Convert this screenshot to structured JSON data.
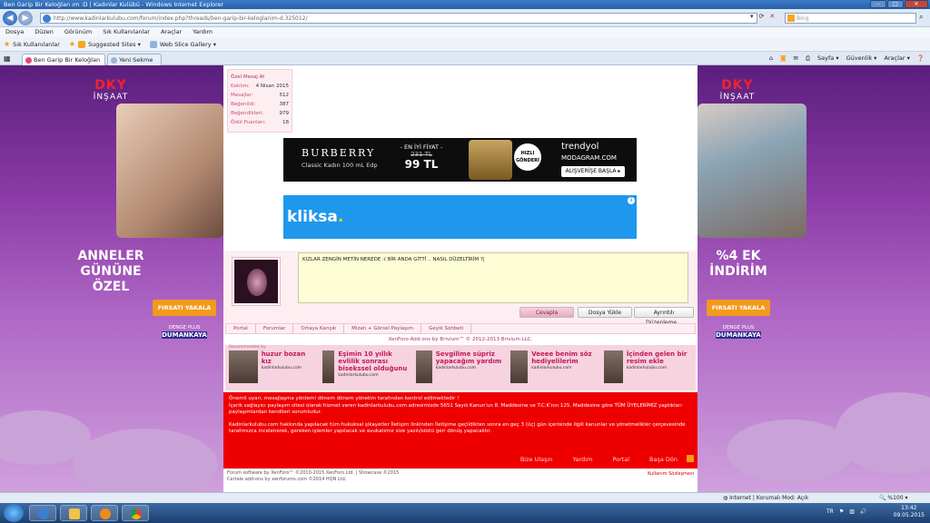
{
  "window": {
    "title": "Ben Garip Bir Keloğlan ım :D | Kadınlar Kulübü - Windows Internet Explorer"
  },
  "address": {
    "url": "http://www.kadinlarkulubu.com/forum/index.php?threads/ben-garip-bir-keloglanim-d.325012/",
    "search_placeholder": "Bing"
  },
  "menu": [
    "Dosya",
    "Düzen",
    "Görünüm",
    "Sık Kullanılanlar",
    "Araçlar",
    "Yardım"
  ],
  "favbar": {
    "favorites": "Sık Kullanılanlar",
    "suggested": "Suggested Sites ▾",
    "webslice": "Web Slice Gallery ▾"
  },
  "tabs": [
    {
      "label": "Ben Garip Bir Keloğlan ı..."
    },
    {
      "label": "Yeni Sekme"
    }
  ],
  "tabtools": [
    "Sayfa ▾",
    "Güvenlik ▾",
    "Araçlar ▾"
  ],
  "ad_left": {
    "logo1a": "DKY",
    "logo2": "İNŞAAT",
    "big": "ANNELER\nGÜNÜNE\nÖZEL",
    "cta": "FIRSATI YAKALA",
    "brand_top": "DENGE PLUS",
    "brand": "DUMANKAYA"
  },
  "ad_right": {
    "logo1a": "DKY",
    "logo2": "İNŞAAT",
    "big": "%4 EK\nİNDİRİM",
    "cta": "FIRSATI YAKALA",
    "brand_top": "DENGE PLUS",
    "brand": "DUMANKAYA"
  },
  "userpanel": {
    "header": "Özel Mesaj At",
    "rows": [
      {
        "k": "Katılım:",
        "v": "4 Nisan 2015"
      },
      {
        "k": "Mesajlar:",
        "v": "512"
      },
      {
        "k": "Beğenildi:",
        "v": "387"
      },
      {
        "k": "Beğendikleri:",
        "v": "979"
      },
      {
        "k": "Ödül Puanları:",
        "v": "18"
      }
    ]
  },
  "banner1": {
    "brand": "BURBERRY",
    "product": "Classic Kadın 100 mL Edp",
    "price_label": "- EN İYİ FİYAT -",
    "old_price": "231 TL",
    "new_price": "99 TL",
    "badge": "HIZLI GÖNDERİ",
    "shop": "trendyol",
    "site": "MODAGRAM.COM",
    "shop_cta": "ALIŞVERİŞE BAŞLA ▸"
  },
  "banner2": {
    "brand_a": "kliksa",
    "brand_b": ".",
    "info": "i"
  },
  "editor": {
    "text": "KIZLAR ZENGİN METİN NEREDE :( BİR ANDA GİTTİ .. NASIL DÜZELTİRİM ?|"
  },
  "buttons": {
    "reply": "Cevapla",
    "upload": "Dosya Yükle",
    "advanced": "Ayrıntılı Düzenleme..."
  },
  "breadcrumb": [
    "Portal",
    "Forumlar",
    "Ortaya Karışık",
    "Mizah + Görsel Paylaşım",
    "Geyik Sohbeti"
  ],
  "footlink": "XenForo Add-ons by Brivium™ © 2012-2013 Brivium LLC.",
  "nativeads": {
    "header": "Recommended by",
    "items": [
      {
        "title": "huzur bozan kız",
        "site": "kadinlarkulubu.com"
      },
      {
        "title": "Eşimin 10 yıllık evlilik sonrası bisekssel olduğunu",
        "site": "kadinlarkulubu.com"
      },
      {
        "title": "Sevgilime süpriz yapacağım yardım",
        "site": "kadinlarkulubu.com"
      },
      {
        "title": "Veeee benim söz hediyelilerim",
        "site": "kadinlarkulubu.com"
      },
      {
        "title": "İçinden gelen bir resim ekle",
        "site": "kadinlarkulubu.com"
      }
    ]
  },
  "warning": {
    "l1": "Önemli uyarı, mesajlaşma yöntemi dönem dönem yönetim tarafından kontrol edilmektedir !",
    "l2": "İçerik sağlayıcı paylaşım sitesi olarak hizmet veren kadinlarkulubu.com adresimizde 5651 Sayılı Kanun'un 8. Maddesine ve T.C.K'nın 125. Maddesine göre TÜM ÜYELERİMİZ yaptıkları paylaşımlardan kendileri sorumludur.",
    "l3": "Kadinlarkulubu.com hakkında yapılacak tüm hukuksal şikayetler İletişim linkinden İletişime geçildikten sonra en geç 3 (üç) gün içerisinde ilgili kanunlar ve yönetmelikler çerçevesinde tarafımızca incelenerek, gereken işlemler yapılacak ve avukatımız size yazılı/sözlü geri dönüş yapacaktır."
  },
  "warnlinks": [
    "Bize Ulaşın",
    "Yardım",
    "Portal",
    "Başa Dön"
  ],
  "copyright": {
    "l1": "Forum software by XenForo™ ©2010-2015 XenForo Ltd. | Showcase ©2015",
    "l2": "Certale add-ons by xenforums.com ©2014 HQN Ltd."
  },
  "terms": "Kullanım Sözleşmesi",
  "status": {
    "zone": "Internet | Korumalı Mod: Açık",
    "zoom": "🔍 %100 ▾"
  },
  "tray": {
    "lang": "TR",
    "time": "13:42",
    "date": "09.05.2015"
  },
  "colors": {
    "accent": "#ef0000",
    "purple": "#8a3aa6",
    "link": "#b03060"
  }
}
